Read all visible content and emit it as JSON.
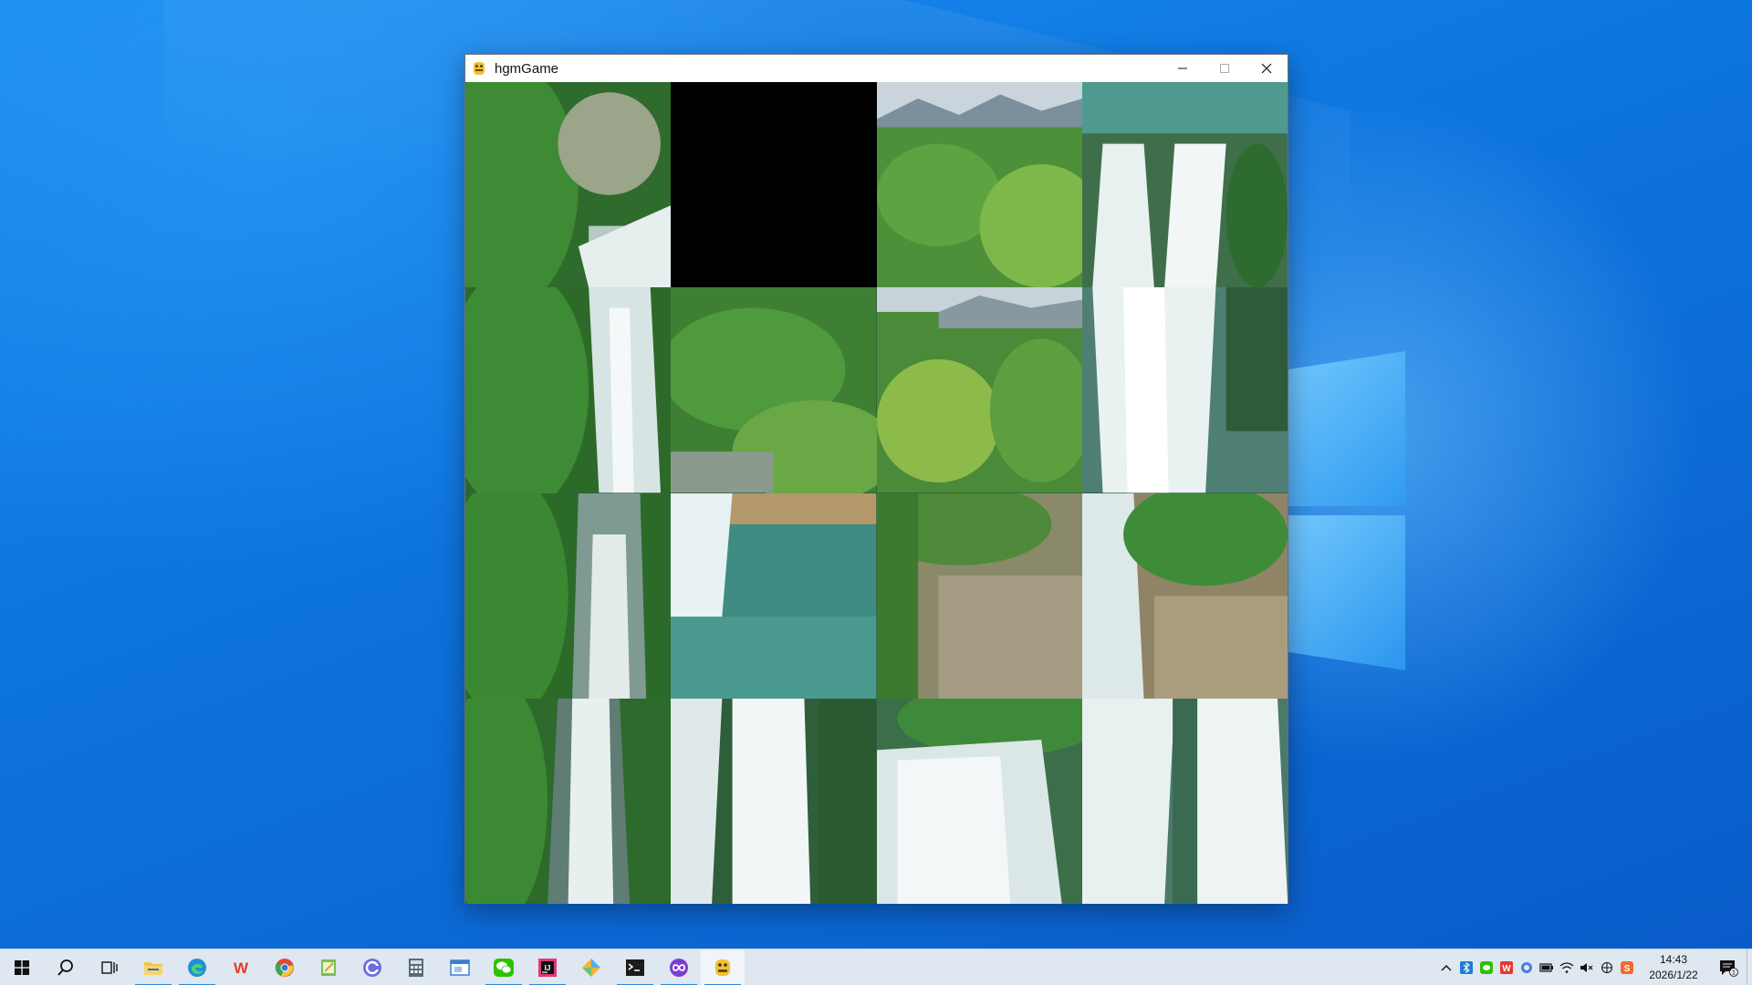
{
  "window": {
    "title": "hgmGame",
    "minimize_label": "Minimize",
    "maximize_label": "Maximize",
    "close_label": "Close"
  },
  "puzzle": {
    "rows": 4,
    "cols": 4,
    "empty_tile": {
      "row": 0,
      "col": 1
    }
  },
  "taskbar": {
    "apps": [
      {
        "id": "start",
        "icon": "windows-start-icon"
      },
      {
        "id": "search",
        "icon": "search-icon"
      },
      {
        "id": "task-view",
        "icon": "task-view-icon"
      },
      {
        "id": "file-explorer",
        "icon": "folder-icon"
      },
      {
        "id": "edge",
        "icon": "edge-browser-icon"
      },
      {
        "id": "wps",
        "icon": "wps-office-icon"
      },
      {
        "id": "chrome",
        "icon": "chrome-browser-icon"
      },
      {
        "id": "notes",
        "icon": "notepad-icon"
      },
      {
        "id": "app-circle",
        "icon": "circle-app-icon"
      },
      {
        "id": "calculator",
        "icon": "calculator-icon"
      },
      {
        "id": "window-app",
        "icon": "window-app-icon"
      },
      {
        "id": "wechat",
        "icon": "wechat-icon"
      },
      {
        "id": "intellij",
        "icon": "intellij-icon"
      },
      {
        "id": "kite",
        "icon": "kite-app-icon"
      },
      {
        "id": "terminal",
        "icon": "terminal-icon"
      },
      {
        "id": "infinity",
        "icon": "infinity-app-icon"
      },
      {
        "id": "python-game",
        "icon": "python-game-icon"
      }
    ],
    "clock": {
      "time": "14:43",
      "date": "2026/1/22"
    },
    "notification_count": "1"
  },
  "colors": {
    "taskbar_bg": "#dfe7f0",
    "accent": "#2f86d8",
    "empty_tile": "#000000"
  }
}
